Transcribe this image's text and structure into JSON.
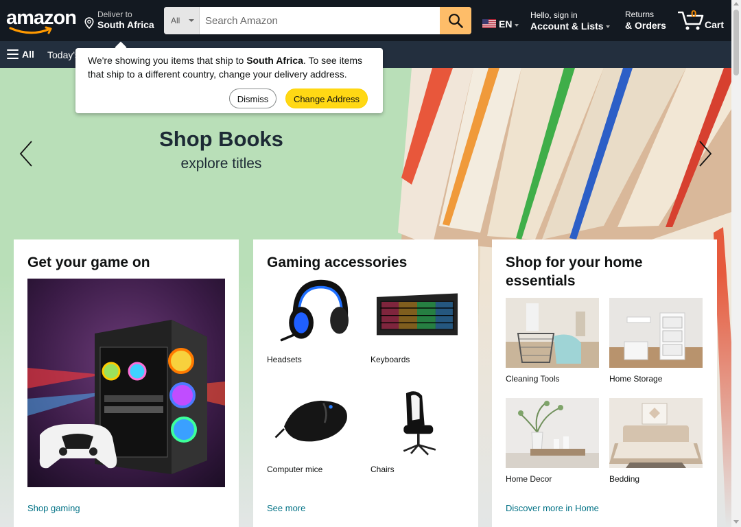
{
  "header": {
    "logo_text": "amazon",
    "deliver_line1": "Deliver to",
    "deliver_line2": "South Africa",
    "search_dept": "All",
    "search_placeholder": "Search Amazon",
    "language": "EN",
    "account_line1": "Hello, sign in",
    "account_line2": "Account & Lists",
    "returns_line1": "Returns",
    "returns_line2": "& Orders",
    "cart_count": "0",
    "cart_label": "Cart"
  },
  "subnav": {
    "all_label": "All",
    "deals_label": "Today's"
  },
  "popover": {
    "message_part1": "We're showing you items that ship to ",
    "message_country": "South Africa",
    "message_part2": ". To see items that ship to a different country, change your delivery address.",
    "dismiss_label": "Dismiss",
    "change_label": "Change Address"
  },
  "hero": {
    "title": "Shop Books",
    "subtitle": "explore titles"
  },
  "cards": [
    {
      "title": "Get your game on",
      "link": "Shop gaming"
    },
    {
      "title": "Gaming accessories",
      "items": [
        "Headsets",
        "Keyboards",
        "Computer mice",
        "Chairs"
      ],
      "link": "See more"
    },
    {
      "title": "Shop for your home essentials",
      "items": [
        "Cleaning Tools",
        "Home Storage",
        "Home Decor",
        "Bedding"
      ],
      "link": "Discover more in Home"
    }
  ],
  "colors": {
    "nav_bg": "#131921",
    "subnav_bg": "#232f3e",
    "search_button": "#febd69",
    "cart_count": "#f08804",
    "link": "#007185",
    "hero_green": "#b9dfb8",
    "change_button": "#ffd814"
  },
  "icons": [
    "location-pin-icon",
    "search-icon",
    "us-flag-icon",
    "cart-icon",
    "hamburger-icon",
    "chevron-left-icon",
    "chevron-right-icon"
  ]
}
